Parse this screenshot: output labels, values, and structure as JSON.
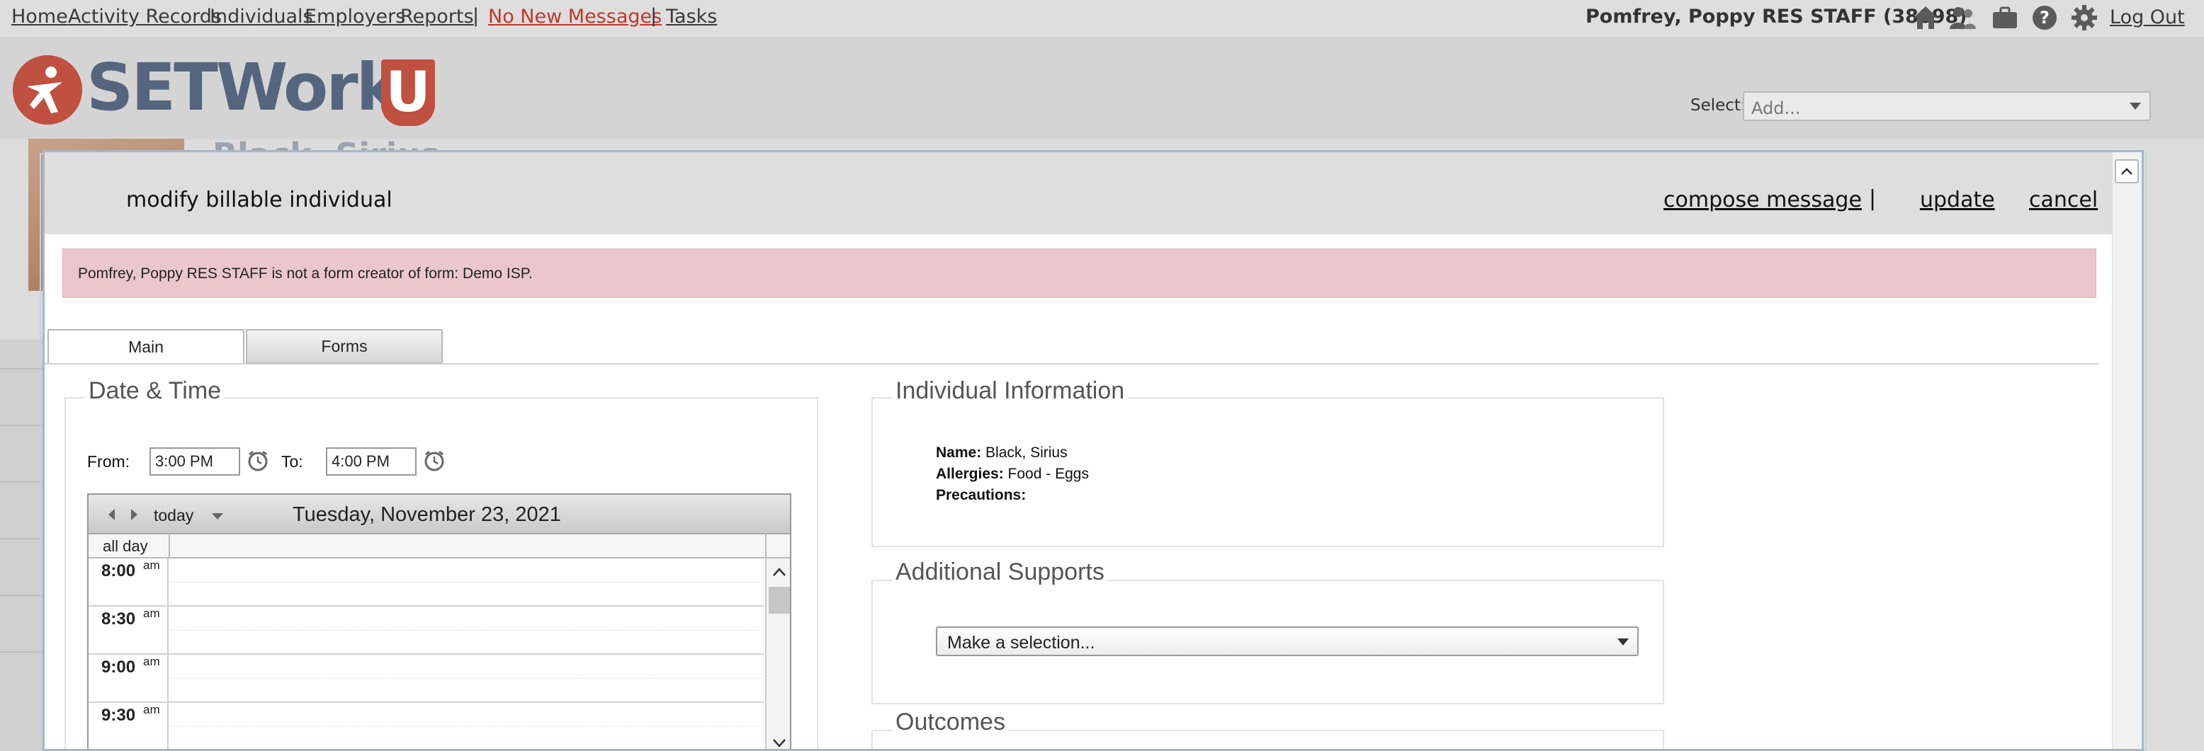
{
  "topnav": {
    "home": "Home",
    "activity_records": "Activity Records",
    "individuals": "Individuals",
    "employers": "Employers",
    "reports": "Reports",
    "separator": "|",
    "messages": "No New Messages",
    "tasks": "Tasks",
    "user": "Pomfrey, Poppy RES STAFF  (38098)",
    "logout": "Log Out",
    "icons": [
      "home-icon",
      "people-icon",
      "briefcase-icon",
      "help-icon",
      "gear-icon"
    ]
  },
  "header": {
    "logo_text": "SETWorks",
    "logo_u": "U",
    "select_label": "Select:",
    "select_value": "Add...",
    "background_name": "Black, Sirius"
  },
  "dialog": {
    "title": "modify billable individual",
    "compose": "compose message",
    "pipe": "|",
    "update": "update",
    "cancel": "cancel",
    "alert": "Pomfrey, Poppy RES STAFF is not a form creator of form: Demo ISP.",
    "tabs": {
      "main": "Main",
      "forms": "Forms"
    },
    "datetime": {
      "legend": "Date & Time",
      "from_label": "From:",
      "from_value": "3:00 PM",
      "to_label": "To:",
      "to_value": "4:00 PM"
    },
    "calendar": {
      "today": "today",
      "date": "Tuesday, November 23, 2021",
      "allday": "all day",
      "slots": [
        {
          "time": "8:00",
          "ampm": "am"
        },
        {
          "time": "8:30",
          "ampm": "am"
        },
        {
          "time": "9:00",
          "ampm": "am"
        },
        {
          "time": "9:30",
          "ampm": "am"
        }
      ]
    },
    "individual": {
      "legend": "Individual Information",
      "name_label": "Name:",
      "name_value": "Black, Sirius",
      "allergies_label": "Allergies:",
      "allergies_value": "Food - Eggs",
      "precautions_label": "Precautions:"
    },
    "supports": {
      "legend": "Additional Supports",
      "select_value": "Make a selection..."
    },
    "outcomes": {
      "legend": "Outcomes"
    }
  },
  "colors": {
    "brand_red": "#c0503f",
    "brand_slate": "#56657e",
    "alert_bg": "#ebc7cc",
    "messages_link": "#c0392b"
  }
}
